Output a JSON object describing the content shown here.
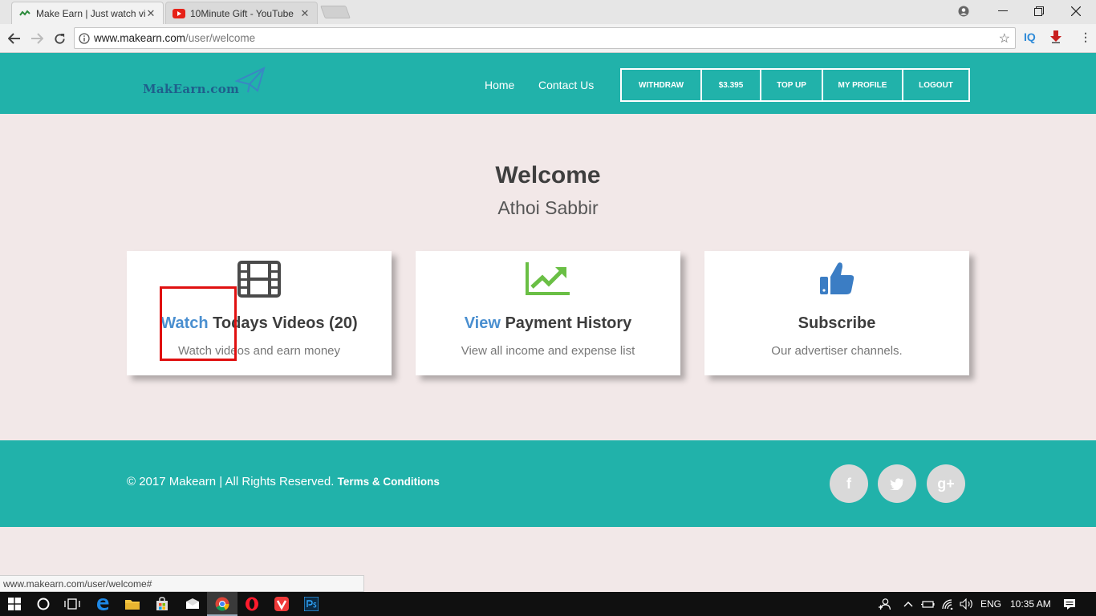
{
  "browser": {
    "tabs": [
      {
        "title": "Make Earn | Just watch vi",
        "close": "✕"
      },
      {
        "title": "10Minute Gift - YouTube",
        "close": "✕"
      }
    ],
    "url_host": "www.makearn.com",
    "url_path": "/user/welcome",
    "status_url": "www.makearn.com/user/welcome#",
    "ext_iq": "IQ"
  },
  "header": {
    "logo": "MakEarn.com",
    "nav": {
      "home": "Home",
      "contact": "Contact Us"
    },
    "buttons": {
      "withdraw": "WITHDRAW",
      "balance": "$3.395",
      "topup": "TOP UP",
      "profile": "MY PROFILE",
      "logout": "LOGOUT"
    }
  },
  "welcome": {
    "title": "Welcome",
    "name": "Athoi Sabbir"
  },
  "cards": [
    {
      "highlight": "Watch",
      "title": " Todays Videos (20)",
      "subtitle": "Watch videos and earn money",
      "icon": "film-icon"
    },
    {
      "highlight": "View",
      "title": " Payment History",
      "subtitle": "View all income and expense list",
      "icon": "chart-trend-icon"
    },
    {
      "highlight": "",
      "title": "Subscribe",
      "subtitle": "Our advertiser channels.",
      "icon": "thumbs-up-icon"
    }
  ],
  "footer": {
    "copyright": "© 2017 Makearn | All Rights Reserved. ",
    "terms": "Terms & Conditions",
    "social": {
      "facebook": "f",
      "twitter": "t",
      "google": "g+"
    }
  },
  "taskbar": {
    "language": "ENG",
    "time": "10:35 AM"
  },
  "colors": {
    "teal": "#21b2aa",
    "page_bg": "#f2e8e8",
    "link_blue": "#4a8fd0",
    "highlight_red": "#e01010"
  }
}
